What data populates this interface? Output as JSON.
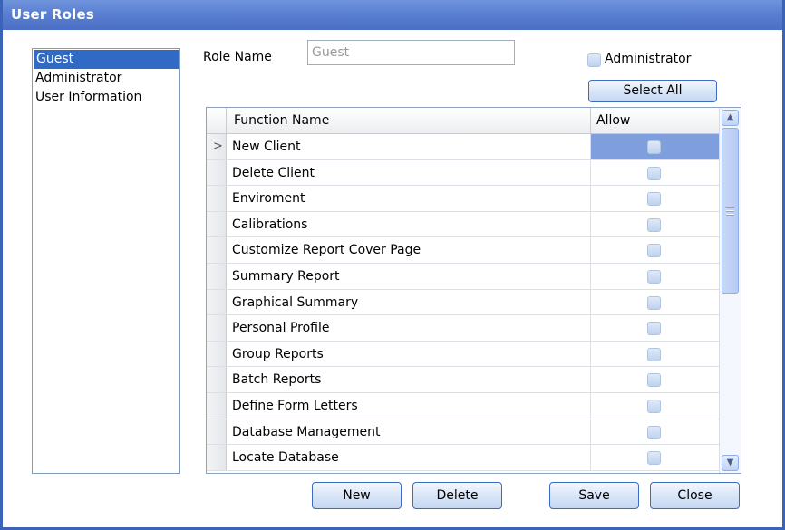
{
  "window": {
    "title": "User Roles"
  },
  "roles": [
    "Guest",
    "Administrator",
    "User Information"
  ],
  "form": {
    "role_name_label": "Role Name",
    "role_name_value": "Guest",
    "administrator_label": "Administrator",
    "select_all_label": "Select All"
  },
  "grid": {
    "headers": {
      "function_name": "Function Name",
      "allow": "Allow"
    },
    "rows": [
      "New Client",
      "Delete Client",
      "Enviroment",
      "Calibrations",
      "Customize Report Cover Page",
      "Summary Report",
      "Graphical Summary",
      "Personal Profile",
      "Group Reports",
      "Batch Reports",
      "Define Form Letters",
      "Database Management",
      "Locate Database"
    ]
  },
  "buttons": {
    "new": "New",
    "delete": "Delete",
    "save": "Save",
    "close": "Close"
  },
  "colors": {
    "titlebar": "#5a80d2",
    "selection": "#316ac5",
    "current_cell": "#7f9edd"
  }
}
